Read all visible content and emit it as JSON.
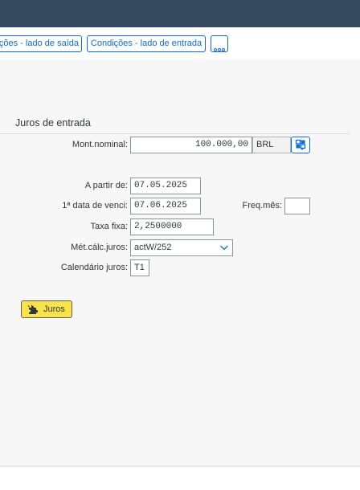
{
  "toolbar": {
    "btn_saida": "ções - lado de saída",
    "btn_entrada": "Condições - lado de entrada",
    "more_icon": "overflow-dots-icon"
  },
  "section": {
    "title": "Juros de entrada"
  },
  "form": {
    "mont_nominal": {
      "label": "Mont.nominal:",
      "value": "100.000,00",
      "currency": "BRL"
    },
    "a_partir_de": {
      "label": "A partir de:",
      "value": "07.05.2025"
    },
    "primeira_data": {
      "label": "1ª data de venci:",
      "value": "07.06.2025"
    },
    "freq_mes": {
      "label": "Freq.mês:",
      "value": ""
    },
    "taxa_fixa": {
      "label": "Taxa fixa:",
      "value": "2,2500000"
    },
    "met_calc": {
      "label": "Mét.cálc.juros:",
      "value": "actW/252"
    },
    "calendario": {
      "label": "Calendário juros:",
      "value": "T1"
    }
  },
  "actions": {
    "juros_label": "Juros",
    "juros_icon": "puzzle-icon"
  },
  "colors": {
    "shell": "#354a5f",
    "accent": "#0a6ed1",
    "emphasized": "#f8e34b",
    "background": "#f7f7f7"
  }
}
